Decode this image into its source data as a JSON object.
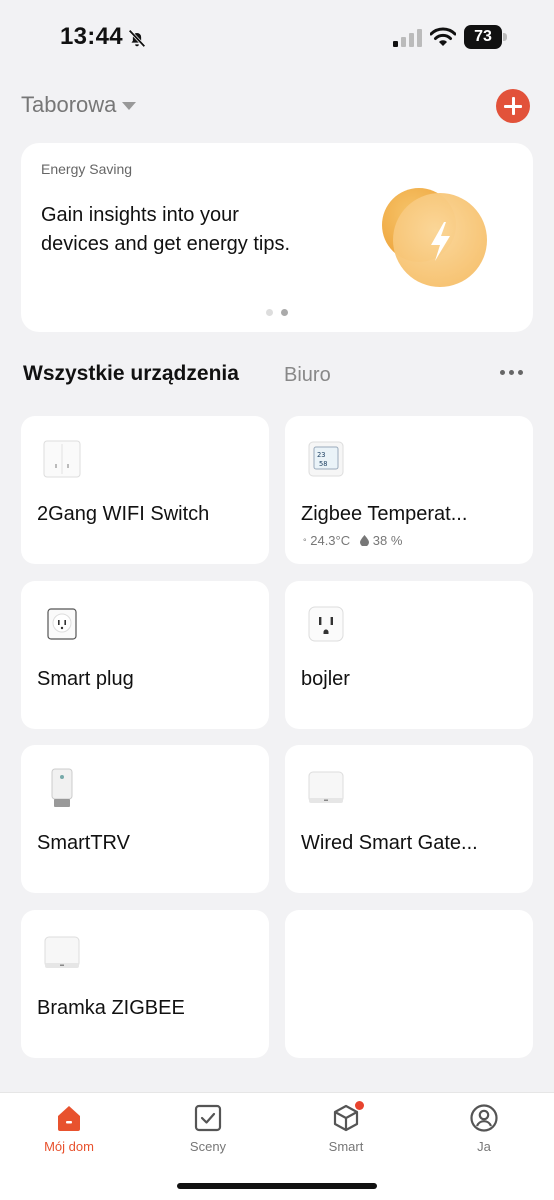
{
  "status_bar": {
    "time": "13:44",
    "battery": "73"
  },
  "header": {
    "home_name": "Taborowa"
  },
  "banner": {
    "label": "Energy Saving",
    "text": "Gain insights into your devices and get energy tips.",
    "page_count": 2,
    "active_page": 2
  },
  "tabs": {
    "all": "Wszystkie urządzenia",
    "room": "Biuro"
  },
  "devices": [
    {
      "name": "2Gang WIFI Switch",
      "icon": "wall-switch-icon"
    },
    {
      "name": "Zigbee Temperat...",
      "icon": "thermometer-display-icon",
      "temperature": "24.3°C",
      "humidity": "38 %"
    },
    {
      "name": "Smart plug",
      "icon": "smart-plug-icon"
    },
    {
      "name": "bojler",
      "icon": "socket-icon"
    },
    {
      "name": "SmartTRV",
      "icon": "radiator-valve-icon"
    },
    {
      "name": "Wired Smart Gate...",
      "icon": "gateway-icon"
    },
    {
      "name": "Bramka ZIGBEE",
      "icon": "gateway-icon"
    }
  ],
  "tabbar": {
    "home": "Mój dom",
    "scenes": "Sceny",
    "smart": "Smart",
    "me": "Ja"
  },
  "colors": {
    "accent": "#e8522e",
    "add_button": "#e2523a",
    "energy_orange": "#f0a640"
  }
}
